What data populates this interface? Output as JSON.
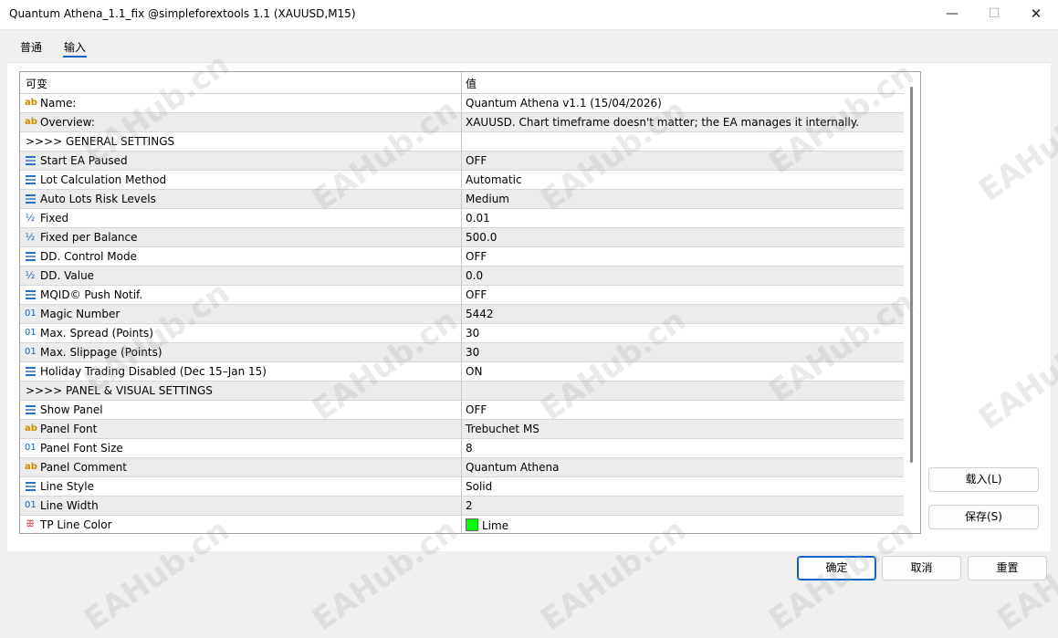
{
  "window": {
    "title": "Quantum Athena_1.1_fix @simpleforextools 1.1 (XAUUSD,M15)",
    "minimize_glyph": "—",
    "maximize_glyph": "☐",
    "close_glyph": "✕"
  },
  "tabs": [
    {
      "label": "普通"
    },
    {
      "label": "输入",
      "active": true
    }
  ],
  "table": {
    "headers": {
      "variable": "可变",
      "value": "值"
    },
    "rows": [
      {
        "icon": "ab-string-icon",
        "glyph": "ab",
        "name": "Name:",
        "value": "Quantum Athena v1.1 (15/04/2026)"
      },
      {
        "icon": "ab-string-icon",
        "glyph": "ab",
        "name": "Overview:",
        "value": "XAUUSD. Chart timeframe doesn't matter; the EA manages it internally."
      },
      {
        "icon": "",
        "glyph": "",
        "name": ">>>> GENERAL SETTINGS",
        "value": "",
        "section": true
      },
      {
        "icon": "enum-icon",
        "glyph": "",
        "name": "Start EA Paused",
        "value": "OFF"
      },
      {
        "icon": "enum-icon",
        "glyph": "",
        "name": "Lot Calculation Method",
        "value": "Automatic"
      },
      {
        "icon": "enum-icon",
        "glyph": "",
        "name": "Auto Lots Risk Levels",
        "value": "Medium"
      },
      {
        "icon": "fraction-icon",
        "glyph": "½",
        "name": "Fixed",
        "value": "0.01"
      },
      {
        "icon": "fraction-icon",
        "glyph": "½",
        "name": "Fixed per Balance",
        "value": "500.0"
      },
      {
        "icon": "enum-icon",
        "glyph": "",
        "name": "DD. Control Mode",
        "value": "OFF"
      },
      {
        "icon": "fraction-icon",
        "glyph": "½",
        "name": "DD. Value",
        "value": "0.0"
      },
      {
        "icon": "enum-icon",
        "glyph": "",
        "name": "MQID© Push Notif.",
        "value": "OFF"
      },
      {
        "icon": "integer-icon",
        "glyph": "01",
        "name": "Magic Number",
        "value": "5442"
      },
      {
        "icon": "integer-icon",
        "glyph": "01",
        "name": "Max. Spread (Points)",
        "value": "30"
      },
      {
        "icon": "integer-icon",
        "glyph": "01",
        "name": "Max. Slippage (Points)",
        "value": "30"
      },
      {
        "icon": "enum-icon",
        "glyph": "",
        "name": "Holiday Trading Disabled (Dec 15–Jan 15)",
        "value": "ON"
      },
      {
        "icon": "",
        "glyph": "",
        "name": ">>>> PANEL & VISUAL SETTINGS",
        "value": "",
        "section": true
      },
      {
        "icon": "enum-icon",
        "glyph": "",
        "name": "Show Panel",
        "value": "OFF"
      },
      {
        "icon": "ab-string-icon",
        "glyph": "ab",
        "name": "Panel Font",
        "value": "Trebuchet MS"
      },
      {
        "icon": "integer-icon",
        "glyph": "01",
        "name": "Panel Font Size",
        "value": "8"
      },
      {
        "icon": "ab-string-icon",
        "glyph": "ab",
        "name": "Panel Comment",
        "value": "Quantum Athena"
      },
      {
        "icon": "enum-icon",
        "glyph": "",
        "name": "Line Style",
        "value": "Solid"
      },
      {
        "icon": "integer-icon",
        "glyph": "01",
        "name": "Line Width",
        "value": "2"
      },
      {
        "icon": "color-icon",
        "glyph": "ꕥ",
        "name": "TP Line Color",
        "value": "Lime",
        "swatch": "#00ff00"
      }
    ]
  },
  "buttons": {
    "load": "载入(L)",
    "save": "保存(S)",
    "ok": "确定",
    "cancel": "取消",
    "reset": "重置"
  },
  "watermark": "EAHub.cn",
  "colors": {
    "accent": "#0a64c8",
    "swatch_lime": "#00ff00"
  }
}
